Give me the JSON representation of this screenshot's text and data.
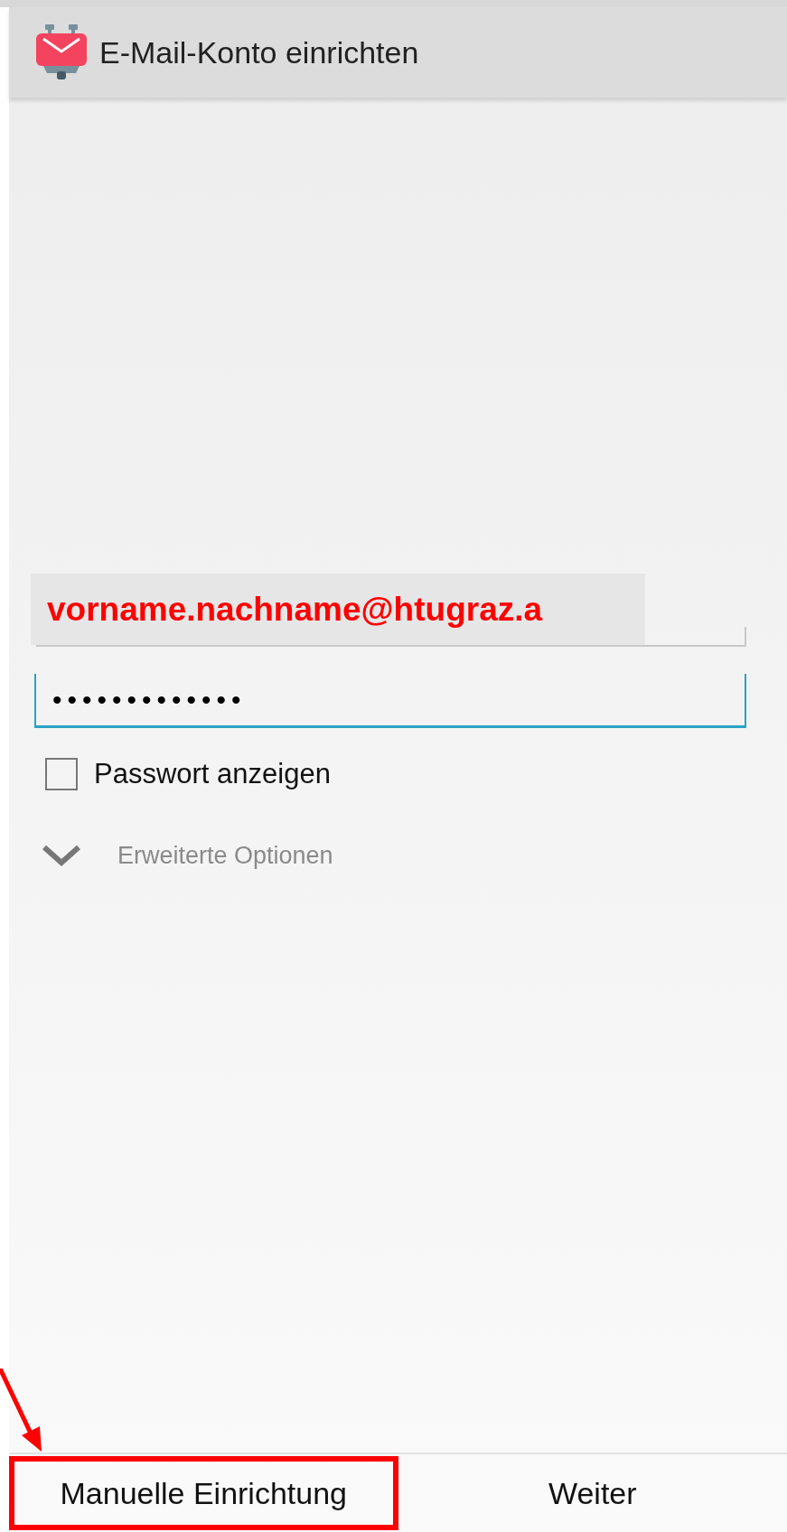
{
  "app_bar": {
    "title": "E-Mail-Konto einrichten"
  },
  "email_field": {
    "value": "vorname.nachname@htugraz.a"
  },
  "password_field": {
    "value": "•••••••••••••",
    "focused": true
  },
  "show_password": {
    "label": "Passwort anzeigen",
    "checked": false
  },
  "advanced_options": {
    "label": "Erweiterte Optionen",
    "expanded": false
  },
  "buttons": [
    {
      "label": "Manuelle Einrichtung",
      "highlighted": true
    },
    {
      "label": "Weiter",
      "highlighted": false
    }
  ]
}
